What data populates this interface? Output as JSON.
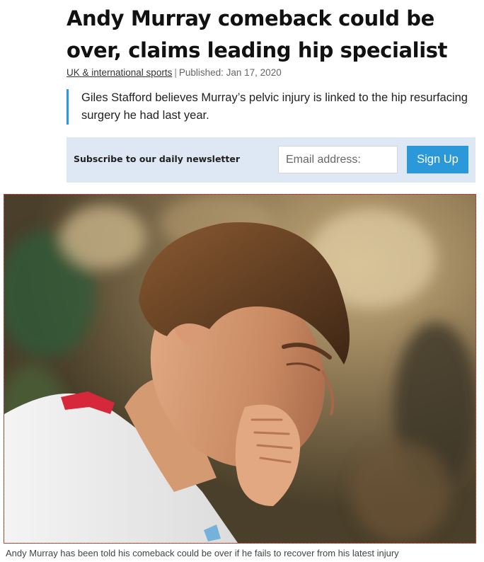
{
  "article": {
    "headline": "Andy Murray comeback could be over, claims leading hip specialist",
    "category_link": "UK & international sports",
    "separator": "|",
    "published": "Published: Jan 17, 2020",
    "standfirst": "Giles Stafford believes Murray’s pelvic injury is linked to the hip resurfacing surgery he had last year."
  },
  "newsletter": {
    "label": "Subscribe to our daily newsletter",
    "email_placeholder": "Email address:",
    "button_label": "Sign Up"
  },
  "figure": {
    "caption": "Andy Murray has been told his comeback could be over if he fails to recover from his latest injury"
  },
  "colors": {
    "accent": "#2a98d9",
    "newsletter_bg": "#dde8f4"
  }
}
